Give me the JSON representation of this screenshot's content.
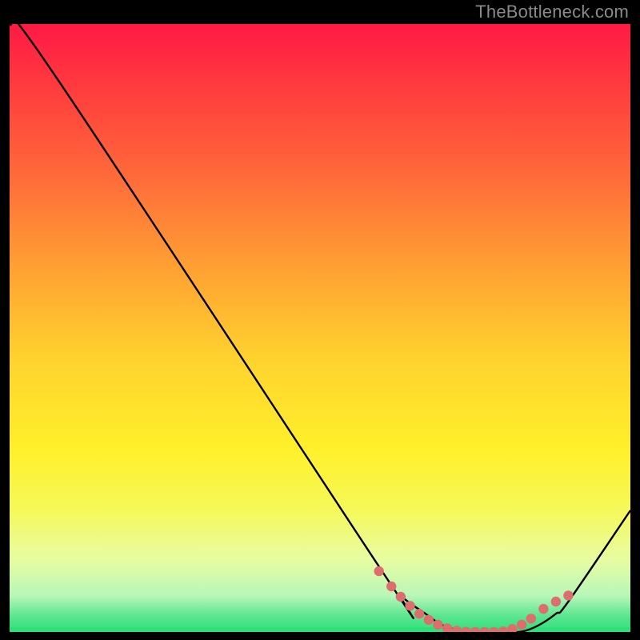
{
  "attribution": "TheBottleneck.com",
  "colors": {
    "background": "#000000",
    "attribution_text": "#8a8a8a",
    "curve_stroke": "#000000",
    "dot_fill": "#de6d6d",
    "optimal_band": "#2fe07a"
  },
  "gradient_stops": [
    {
      "offset": 0.0,
      "color": "#ff1945"
    },
    {
      "offset": 0.1,
      "color": "#ff3a3e"
    },
    {
      "offset": 0.25,
      "color": "#ff6a3a"
    },
    {
      "offset": 0.4,
      "color": "#ffa033"
    },
    {
      "offset": 0.55,
      "color": "#ffd22e"
    },
    {
      "offset": 0.7,
      "color": "#fff02a"
    },
    {
      "offset": 0.8,
      "color": "#f5f95a"
    },
    {
      "offset": 0.88,
      "color": "#e8fca2"
    },
    {
      "offset": 0.94,
      "color": "#b8f7b8"
    },
    {
      "offset": 0.975,
      "color": "#58e58f"
    },
    {
      "offset": 1.0,
      "color": "#2fe07a"
    }
  ],
  "chart_data": {
    "type": "line",
    "title": "",
    "xlabel": "",
    "ylabel": "",
    "xlim": [
      0,
      100
    ],
    "ylim": [
      0,
      100
    ],
    "note": "Axis values are normalized estimates; no tick labels are shown in the source image.",
    "series": [
      {
        "name": "bottleneck-curve",
        "x": [
          0,
          7,
          60,
          63,
          67,
          70,
          74,
          78,
          82,
          85,
          88,
          90,
          100
        ],
        "y": [
          100,
          92,
          10,
          6,
          3,
          1,
          0,
          0,
          0,
          1,
          3,
          5,
          20
        ]
      }
    ],
    "highlight_points": {
      "name": "optimal-range-dots",
      "x": [
        59.5,
        61.5,
        63.0,
        64.5,
        66.0,
        67.5,
        69.0,
        70.5,
        72.0,
        73.5,
        75.0,
        76.5,
        78.0,
        79.5,
        81.0,
        82.5,
        84.0,
        86.0,
        88.0,
        90.0
      ],
      "y": [
        10.0,
        7.5,
        5.8,
        4.3,
        3.0,
        2.0,
        1.2,
        0.6,
        0.2,
        0.05,
        0.0,
        0.0,
        0.0,
        0.1,
        0.5,
        1.2,
        2.2,
        3.8,
        5.0,
        6.0
      ]
    }
  },
  "plot_geometry": {
    "inner_left": 12,
    "inner_top": 30,
    "inner_width": 776,
    "inner_height": 760
  }
}
